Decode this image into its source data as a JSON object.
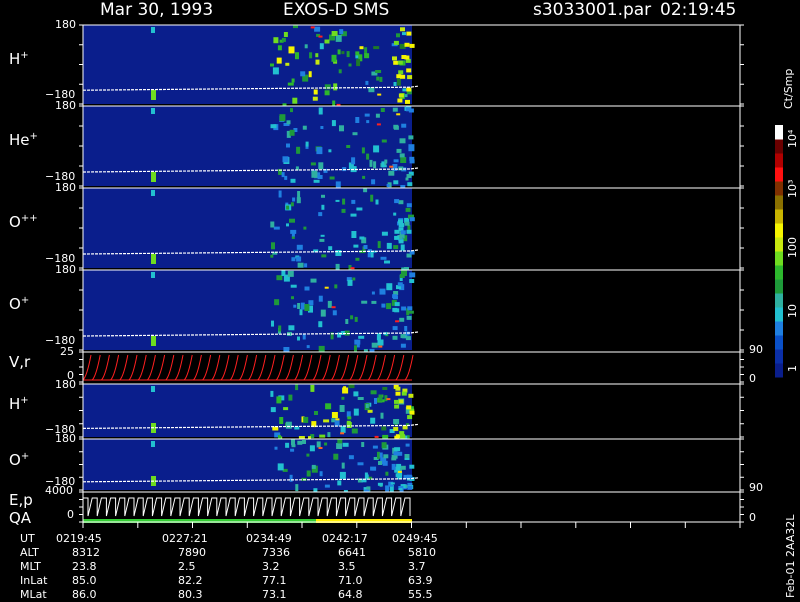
{
  "header": {
    "date": "Mar 30, 1993",
    "instrument": "EXOS-D SMS",
    "file": "s3033001.par",
    "time": "02:19:45"
  },
  "side_label": "Feb-01 2AA32L",
  "chart_data": {
    "type": "heatmap",
    "colors": {
      "background": "#000000",
      "panel_bg": "#0a1e8c",
      "trace": "#ffffff",
      "wave": "#ff2020",
      "qa_green": "#33cc33",
      "qa_yellow": "#ffee00"
    },
    "colorbar": {
      "unit": "Ct/Smp",
      "ticks": [
        "1",
        "10",
        "100",
        "10³",
        "10⁴"
      ],
      "colors": [
        "#0a1e8c",
        "#0b2fa8",
        "#0a50c8",
        "#1f7fe0",
        "#22c0d0",
        "#2fb0a0",
        "#1e9a3a",
        "#2db82d",
        "#6fdc20",
        "#c8e80f",
        "#f5f500",
        "#c8b400",
        "#8a7000",
        "#803000",
        "#ff1010",
        "#b00000",
        "#6a0000",
        "#ffffff"
      ]
    },
    "panels": [
      {
        "label_base": "H",
        "label_sup": "+",
        "ymax": "180",
        "ymin": "−180",
        "type": "ion"
      },
      {
        "label_base": "He",
        "label_sup": "+",
        "ymax": "180",
        "ymin": "−180",
        "type": "ion"
      },
      {
        "label_base": "O",
        "label_sup": "++",
        "ymax": "180",
        "ymin": "−180",
        "type": "ion"
      },
      {
        "label_base": "O",
        "label_sup": "+",
        "ymax": "180",
        "ymin": "−180",
        "type": "ion"
      },
      {
        "label_base": "V,r",
        "label_sup": "",
        "ymax": "25",
        "ymin": "0",
        "right_top": "90",
        "right_bottom": "0",
        "type": "line"
      },
      {
        "label_base": "H",
        "label_sup": "+",
        "ymax": "180",
        "ymin": "−180",
        "type": "ion"
      },
      {
        "label_base": "O",
        "label_sup": "+",
        "ymax": "180",
        "ymin": "−180",
        "type": "ion"
      },
      {
        "label_base": "E,p",
        "label_sup": "",
        "ymax": "4000",
        "ymin": "0",
        "right_top": "90",
        "right_bottom": "0",
        "extra_label": "QA",
        "type": "energy"
      }
    ],
    "footer": {
      "rows": [
        {
          "label": "UT",
          "values": [
            "0219:45",
            "0227:21",
            "0234:49",
            "0242:17",
            "0249:45"
          ]
        },
        {
          "label": "ALT",
          "values": [
            "8312",
            "7890",
            "7336",
            "6641",
            "5810"
          ]
        },
        {
          "label": "MLT",
          "values": [
            "23.8",
            "2.5",
            "3.2",
            "3.5",
            "3.7"
          ]
        },
        {
          "label": "InLat",
          "values": [
            "85.0",
            "82.2",
            "77.1",
            "71.0",
            "63.9"
          ]
        },
        {
          "label": "MLat",
          "values": [
            "86.0",
            "80.3",
            "73.1",
            "64.8",
            "55.5"
          ]
        }
      ]
    }
  }
}
